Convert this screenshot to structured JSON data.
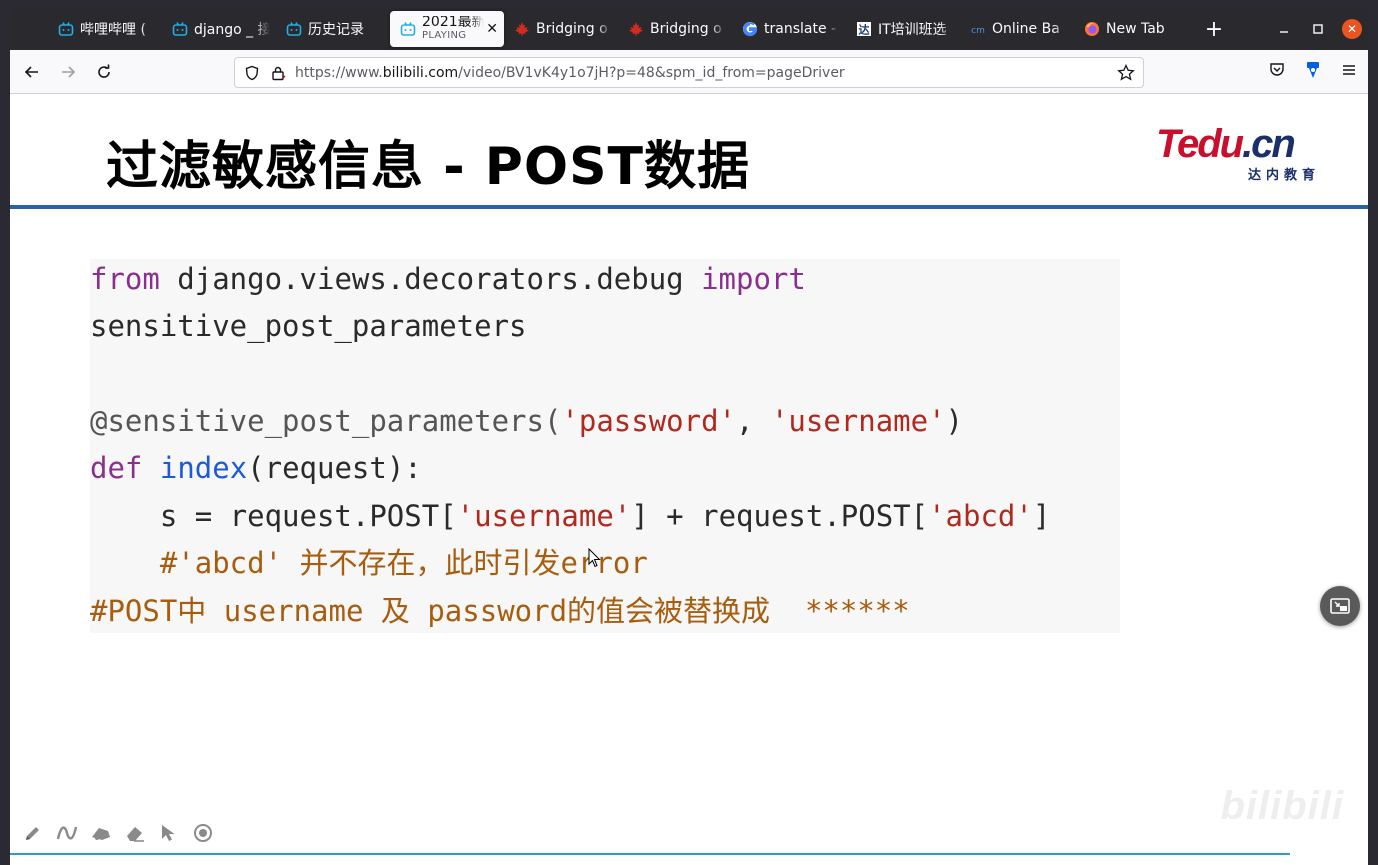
{
  "browser": {
    "tabs": [
      {
        "label": "哔哩哔哩 (",
        "icon": "bilibili-icon",
        "active": false
      },
      {
        "label": "django _ 接",
        "icon": "bilibili-icon",
        "active": false
      },
      {
        "label": "历史记录",
        "icon": "bilibili-icon",
        "active": false
      },
      {
        "label": "2021最新",
        "sublabel": "PLAYING",
        "icon": "bilibili-icon",
        "active": true
      },
      {
        "label": "Bridging o",
        "icon": "maple-leaf-icon",
        "active": false
      },
      {
        "label": "Bridging o",
        "icon": "maple-leaf-icon",
        "active": false
      },
      {
        "label": "translate -",
        "icon": "google-icon",
        "active": false
      },
      {
        "label": "IT培训班选",
        "icon": "site-icon",
        "active": false
      },
      {
        "label": "Online Ba",
        "icon": "cm-icon",
        "active": false
      },
      {
        "label": "New Tab",
        "icon": "firefox-icon",
        "active": false
      }
    ],
    "url": {
      "prefix": "https://www.",
      "domain": "bilibili.com",
      "path": "/video/BV1vK4y1o7jH?p=48&spm_id_from=pageDriver"
    }
  },
  "slide": {
    "title": "过滤敏感信息 - POST数据",
    "logo": {
      "main": "Tedu",
      "suffix": ".cn",
      "sub": "达内教育"
    },
    "code": {
      "l1_kw1": "from",
      "l1_mod": " django.views.decorators.debug ",
      "l1_kw2": "import",
      "l2": "sensitive_post_parameters",
      "l4_dec": "@sensitive_post_parameters(",
      "l4_s1": "'password'",
      "l4_sep": ", ",
      "l4_s2": "'username'",
      "l4_end": ")",
      "l5_kw": "def",
      "l5_sp": " ",
      "l5_fn": "index",
      "l5_rest": "(request):",
      "l6_a": "    s = request.POST[",
      "l6_s1": "'username'",
      "l6_b": "] + request.POST[",
      "l6_s2": "'abcd'",
      "l6_c": "]",
      "l7": "    #'abcd' 并不存在，此时引发error",
      "l8": "#POST中 username 及 password的值会被替换成  ******"
    }
  },
  "player": {
    "watermark": "bilibili",
    "tools": [
      "pen-icon",
      "curve-icon",
      "brush-icon",
      "eraser-icon",
      "pointer-icon",
      "record-icon"
    ]
  },
  "colors": {
    "accent_rule": "#2465a6",
    "keyword": "#8a2f8e",
    "string": "#b0281e",
    "comment": "#a85d0e",
    "function": "#1e5ad6"
  }
}
